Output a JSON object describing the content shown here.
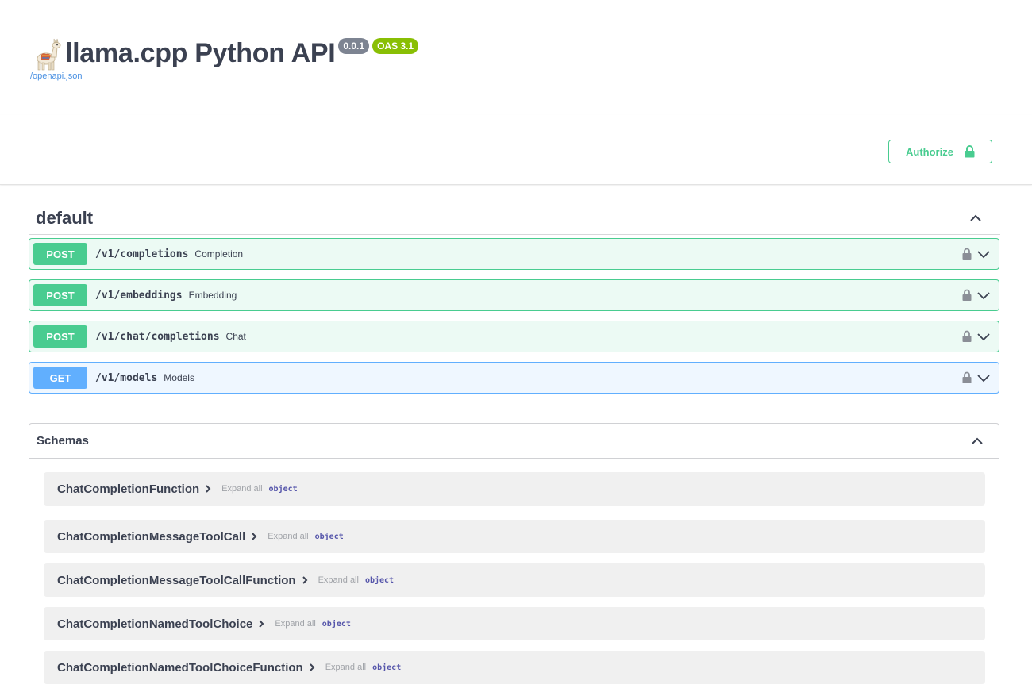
{
  "info": {
    "title": "llama.cpp Python API",
    "version": "0.0.1",
    "oas": "OAS 3.1",
    "spec_link": "/openapi.json"
  },
  "authorize": {
    "label": "Authorize"
  },
  "tag": {
    "name": "default"
  },
  "operations": [
    {
      "method": "POST",
      "path": "/v1/completions",
      "summary": "Completion"
    },
    {
      "method": "POST",
      "path": "/v1/embeddings",
      "summary": "Embedding"
    },
    {
      "method": "POST",
      "path": "/v1/chat/completions",
      "summary": "Chat"
    },
    {
      "method": "GET",
      "path": "/v1/models",
      "summary": "Models"
    }
  ],
  "schemas": {
    "title": "Schemas",
    "items": [
      {
        "name": "ChatCompletionFunction",
        "expand": "Expand all",
        "type": "object"
      },
      {
        "name": "ChatCompletionMessageToolCall",
        "expand": "Expand all",
        "type": "object"
      },
      {
        "name": "ChatCompletionMessageToolCallFunction",
        "expand": "Expand all",
        "type": "object"
      },
      {
        "name": "ChatCompletionNamedToolChoice",
        "expand": "Expand all",
        "type": "object"
      },
      {
        "name": "ChatCompletionNamedToolChoiceFunction",
        "expand": "Expand all",
        "type": "object"
      }
    ]
  },
  "colors": {
    "post": "#49cc90",
    "get": "#61affe",
    "version_badge": "#7d8492",
    "oas_badge": "#89bf04",
    "link": "#4990e2"
  }
}
